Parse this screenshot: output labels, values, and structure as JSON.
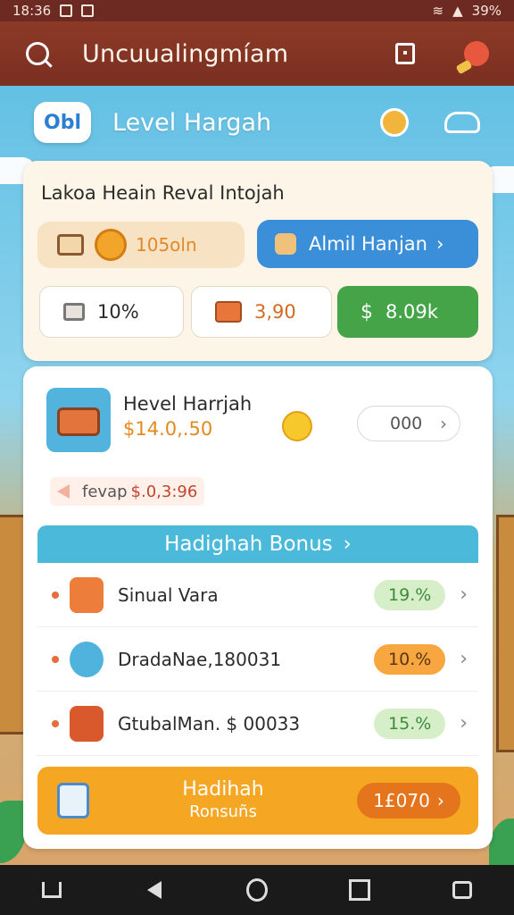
{
  "status_bar": {
    "time": "18:36",
    "battery": "39%"
  },
  "app_bar": {
    "title": "Uncuualingmíam"
  },
  "header": {
    "logo_text": "Obl",
    "title": "Level Hargah"
  },
  "top_card": {
    "subtitle": "Lakoa Heain Reval Intojah",
    "coins": "105oln",
    "cta_label": "Almil Hanjan",
    "stats": [
      "10%",
      "3,90",
      "8.09k"
    ]
  },
  "product": {
    "name": "Hevel Harrjah",
    "price": "$14.0,.50",
    "quantity": "000",
    "saved_label": "fevap",
    "saved_amount": "$.0,3:96"
  },
  "bonus": {
    "title": "Hadighah Bonus",
    "items": [
      {
        "label": "Sinual Vara",
        "percent": "19.%"
      },
      {
        "label": "DradaNae,180031",
        "percent": "10.%"
      },
      {
        "label": "GtubalMan. $ 00033",
        "percent": "15.%"
      }
    ]
  },
  "footer_cta": {
    "line1": "Hadihah",
    "line2": "Ronsuñs",
    "button": "1£070"
  },
  "colors": {
    "accent_orange": "#f5a623",
    "accent_blue": "#3a8fd8",
    "accent_green": "#45a447",
    "bar_red": "#7b2f21"
  }
}
